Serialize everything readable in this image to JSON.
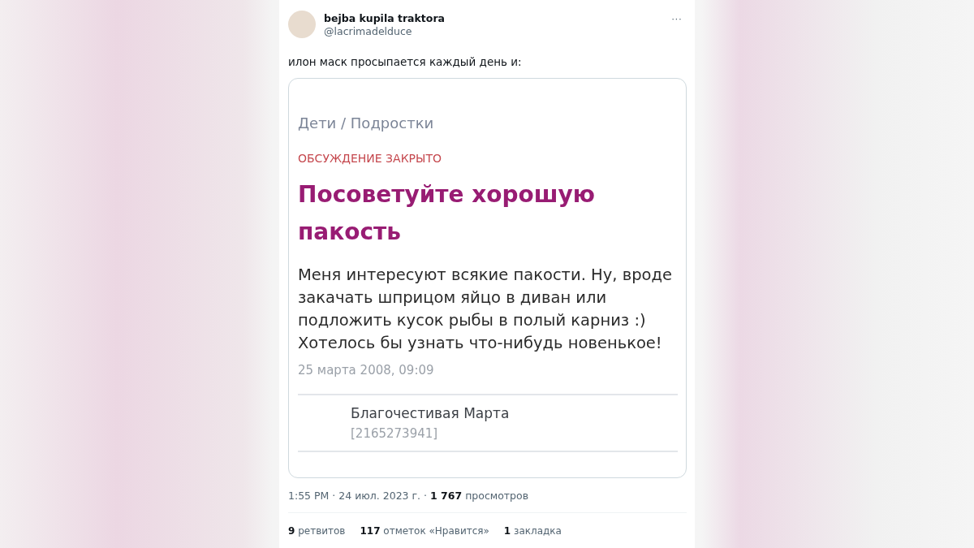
{
  "tweet": {
    "author_name": "bejba kupila traktora",
    "handle": "@lacrimadelduce",
    "more": "···",
    "text": "илон маск просыпается каждый день и:",
    "card": {
      "breadcrumb": "Дети / Подростки",
      "status": "ОБСУЖДЕНИЕ ЗАКРЫТО",
      "title": "Посоветуйте хорошую пакость",
      "body": "Меня интересуют всякие пакости. Ну, вроде закачать шприцом яйцо в диван или подложить кусок рыбы в полый карниз :) Хотелось бы узнать что-нибудь новенькое!",
      "date": "25 марта 2008, 09:09",
      "commenter": "Благочестивая Марта",
      "commenter_id": "[2165273941]"
    },
    "meta": "1:55 PM · 24 июл. 2023 г. · **1 767** просмотров",
    "stats": [
      "**9** ретвитов",
      "**117** отметок «Нравится»",
      "**1** закладка"
    ]
  }
}
